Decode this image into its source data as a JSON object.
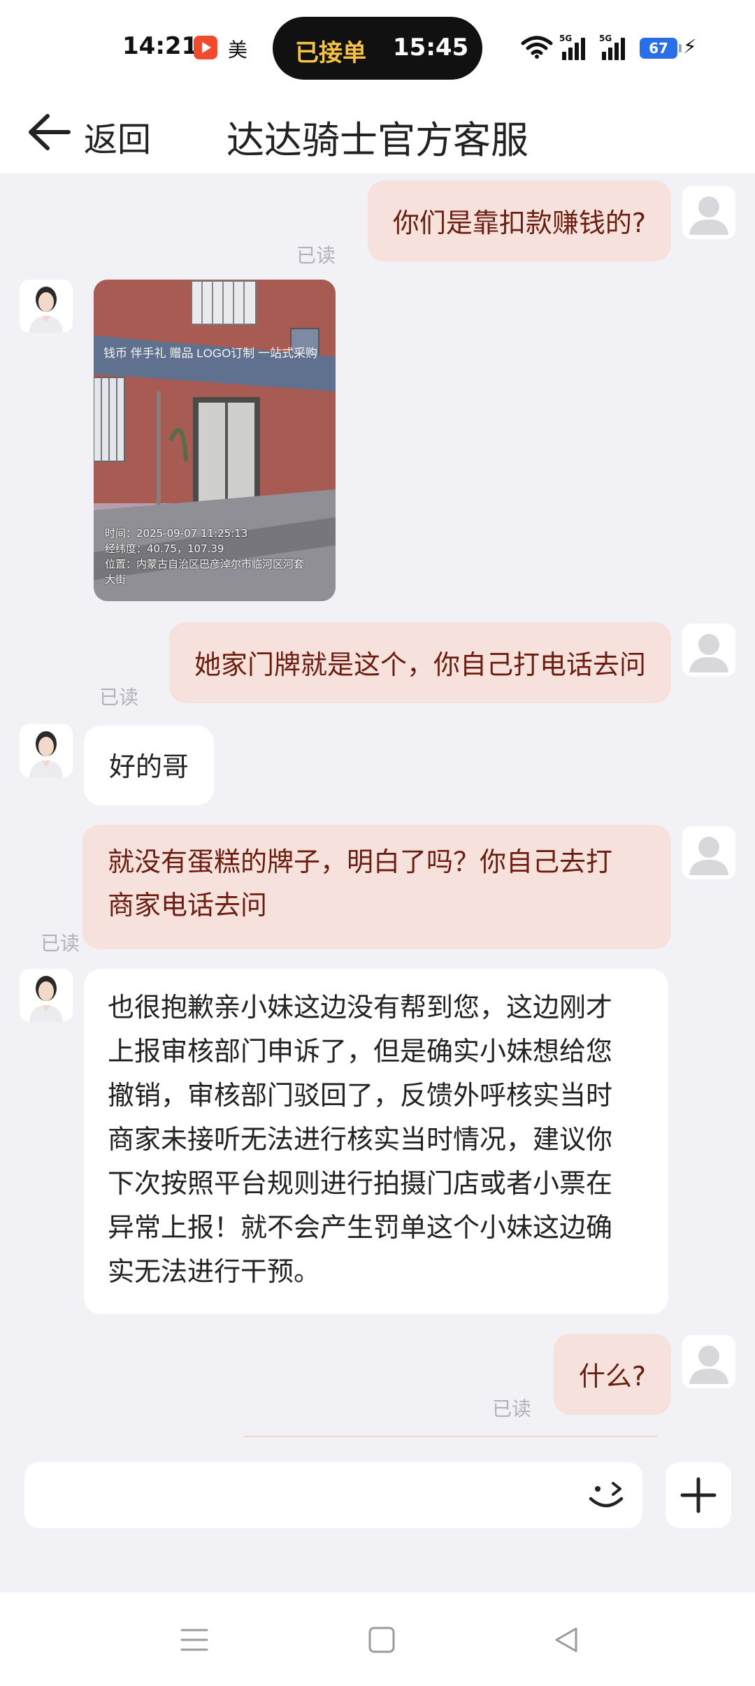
{
  "status_bar": {
    "time": "14:21",
    "app_label": "美",
    "order_status": "已接单",
    "order_time": "15:45",
    "battery": "67"
  },
  "header": {
    "back_label": "返回",
    "title": "达达骑士官方客服"
  },
  "messages": [
    {
      "from": "user",
      "text": "你们是靠扣款赚钱的?",
      "read": "已读"
    },
    {
      "from": "agent",
      "type": "image",
      "image_caption": [
        "时间：2025-09-07 11:25:13",
        "经纬度：40.75，107.39",
        "位置：内蒙古自治区巴彦淖尔市临河区河套",
        "大街"
      ]
    },
    {
      "from": "user",
      "text": "她家门牌就是这个，你自己打电话去问",
      "read": "已读"
    },
    {
      "from": "agent",
      "text": "好的哥"
    },
    {
      "from": "user",
      "lines": [
        "就没有蛋糕的牌子，明白了吗？你自己去打",
        "商家电话去问"
      ],
      "read": "已读"
    },
    {
      "from": "agent",
      "lines": [
        "也很抱歉亲小妹这边没有帮到您，这边刚才",
        "上报审核部门申诉了，但是确实小妹想给您",
        "撤销，审核部门驳回了，反馈外呼核实当时",
        "商家未接听无法进行核实当时情况，建议你",
        "下次按照平台规则进行拍摄门店或者小票在",
        "异常上报！就不会产生罚单这个小妹这边确",
        "实无法进行干预。"
      ]
    },
    {
      "from": "user",
      "text": "什么?",
      "read": "已读"
    }
  ],
  "photo_signage": "钱币 伴手礼 赠品 LOGO订制 一站式采购",
  "colors": {
    "out_bubble": "#f7e1dc",
    "out_text": "#6b1e10",
    "order_status_text": "#f7c244"
  },
  "icons": [
    "back-arrow-icon",
    "emoji-icon",
    "plus-icon",
    "menu-icon",
    "home-icon",
    "back-triangle-icon"
  ]
}
